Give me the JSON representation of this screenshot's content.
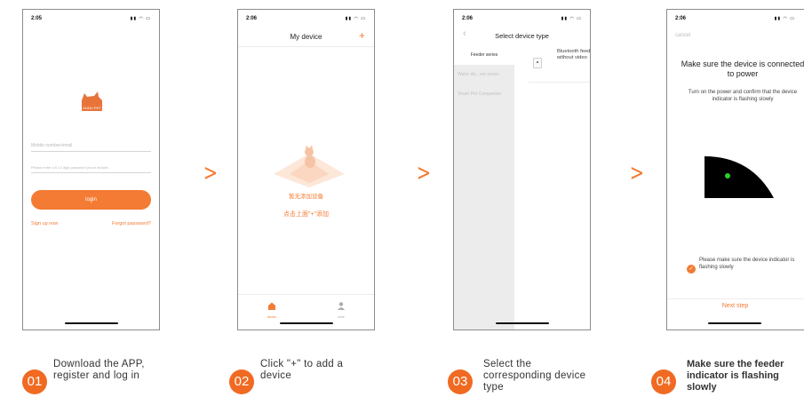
{
  "colors": {
    "accent": "#f47b33",
    "badge": "#f06a22"
  },
  "phone1": {
    "time": "2:05",
    "status_icons": "signal wifi battery",
    "logo_text": "DUDU PET",
    "mobile_placeholder": "Mobile number/email",
    "password_placeholder": "Please enter a 6-12 digit password (must include...",
    "login_label": "login",
    "signup_label": "Sign up now",
    "forgot_label": "Forgot password?"
  },
  "phone2": {
    "time": "2:06",
    "title": "My device",
    "add_label": "+",
    "empty_line1": "暂无添加设备",
    "empty_line2": "点击上面\"+\"添加",
    "tabs": [
      {
        "label": "device",
        "icon": "home-icon"
      },
      {
        "label": "mine",
        "icon": "user-icon"
      }
    ]
  },
  "phone3": {
    "time": "2:06",
    "title": "Select device type",
    "categories": [
      "Feeder series",
      "Water dis...ser series",
      "Smart Pet Companion"
    ],
    "device_name": "Bluetooth feeder without video"
  },
  "phone4": {
    "time": "2:06",
    "cancel_label": "cancel",
    "title": "Make sure the device is connected to power",
    "subtitle": "Turn on the power and confirm that the device indicator is flashing slowly",
    "check_text": "Please make sure the device indicator is flashing slowly",
    "next_label": "Next step"
  },
  "arrows": [
    ">",
    ">",
    ">"
  ],
  "steps": [
    {
      "number": "01",
      "line1": "Download the APP,",
      "line2": "register and log in",
      "line3": ""
    },
    {
      "number": "02",
      "line1": "Click \"+\" to add a",
      "line2": "device",
      "line3": ""
    },
    {
      "number": "03",
      "line1": "Select the",
      "line2": "corresponding device",
      "line3": "type"
    },
    {
      "number": "04",
      "line1": "Make sure the feeder",
      "line2": "indicator is flashing",
      "line3": "slowly"
    }
  ]
}
